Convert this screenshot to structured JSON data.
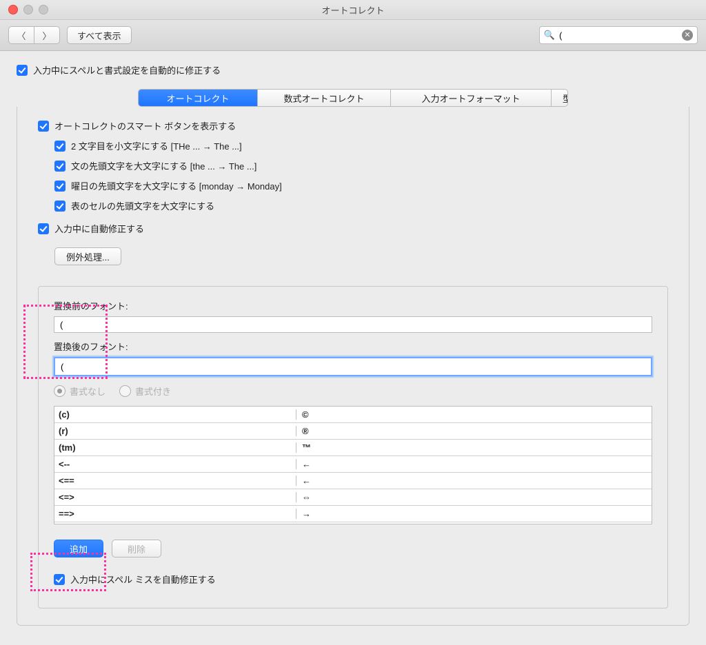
{
  "window": {
    "title": "オートコレクト"
  },
  "toolbar": {
    "show_all": "すべて表示",
    "search_value": "(",
    "back_glyph": "〈",
    "fwd_glyph": "〉"
  },
  "top_checkbox": "入力中にスペルと書式設定を自動的に修正する",
  "tabs": {
    "t1": "オートコレクト",
    "t2": "数式オートコレクト",
    "t3": "入力オートフォーマット",
    "t4": "定型句"
  },
  "opts": {
    "smart": "オートコレクトのスマート ボタンを表示する",
    "c1": "2 文字目を小文字にする [THe ... → The ...]",
    "c2": "文の先頭文字を大文字にする [the ... → The ...]",
    "c3": "曜日の先頭文字を大文字にする [monday →    Monday]",
    "c4": "表のセルの先頭文字を大文字にする",
    "auto": "入力中に自動修正する",
    "exceptions": "例外処理..."
  },
  "replace": {
    "before_label": "置換前のフォント:",
    "after_label": "置換後のフォント:",
    "before_value": "(",
    "after_value": "(",
    "radio_plain": "書式なし",
    "radio_formatted": "書式付き",
    "add": "追加",
    "delete": "削除",
    "spellfix": "入力中にスペル ミスを自動修正する",
    "rows": [
      {
        "a": "(c)",
        "b": "©"
      },
      {
        "a": "(r)",
        "b": "®"
      },
      {
        "a": "(tm)",
        "b": "™"
      },
      {
        "a": "<--",
        "b": "←"
      },
      {
        "a": "<==",
        "b": "←"
      },
      {
        "a": "<=>",
        "b": "⇔"
      },
      {
        "a": "==>",
        "b": "→"
      }
    ]
  }
}
